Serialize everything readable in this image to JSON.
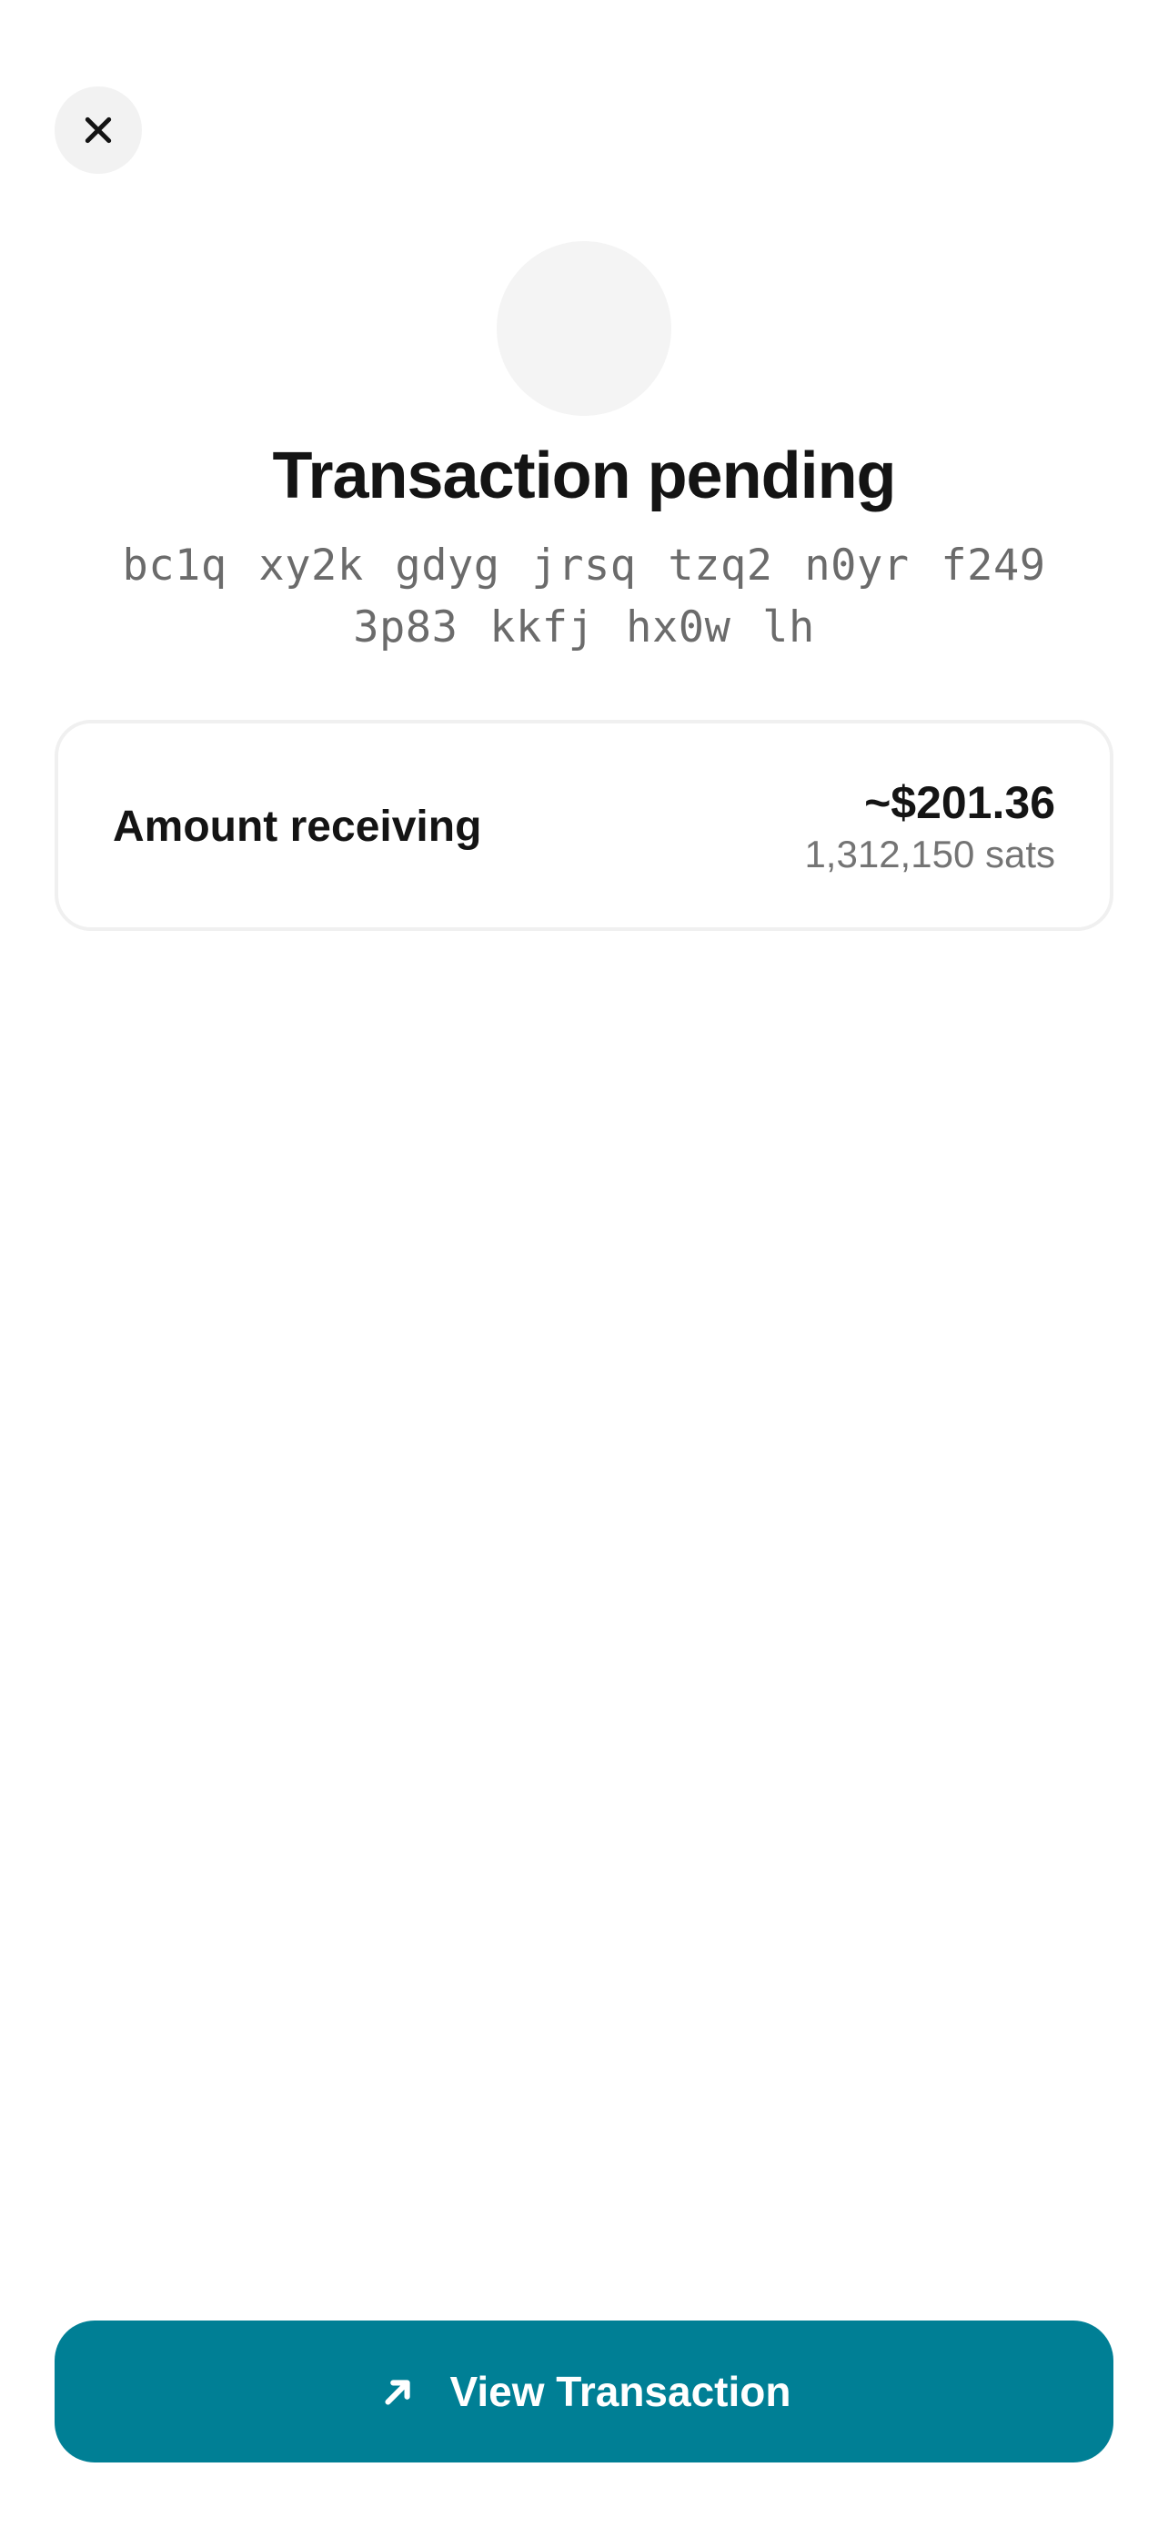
{
  "header": {
    "close_icon": "close-icon"
  },
  "status": {
    "title": "Transaction pending",
    "address": "bc1q xy2k gdyg jrsq tzq2 n0yr f249 3p83 kkfj hx0w lh"
  },
  "amount_card": {
    "label": "Amount receiving",
    "usd_value": "~$201.36",
    "sats_value": "1,312,150 sats"
  },
  "actions": {
    "view_transaction_label": "View Transaction",
    "view_transaction_icon": "arrow-up-right-icon"
  },
  "colors": {
    "accent": "#007f95",
    "close_bg": "#f2f2f2",
    "avatar_bg": "#f4f4f4"
  }
}
